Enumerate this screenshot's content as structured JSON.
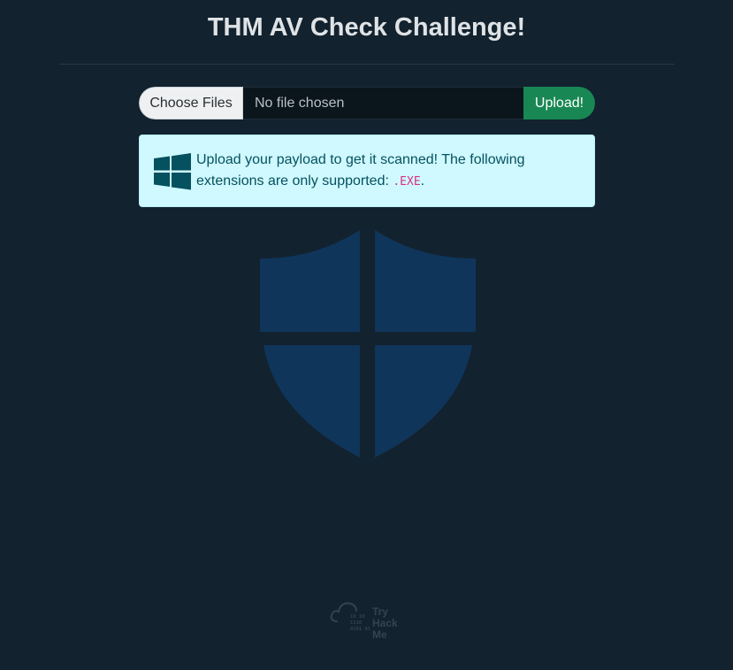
{
  "header": {
    "title": "THM AV Check Challenge!"
  },
  "upload": {
    "choose_label": "Choose Files",
    "file_status": "No file chosen",
    "submit_label": "Upload!"
  },
  "alert": {
    "message_prefix": "Upload your payload to get it scanned! The following extensions are only supported: ",
    "extension": ".EXE",
    "message_suffix": "."
  },
  "footer": {
    "brand_line1": "Try",
    "brand_line2": "Hack",
    "brand_line3": "Me",
    "logo_bits_1": "10 10",
    "logo_bits_2": "1110",
    "logo_bits_3": "0101 01"
  },
  "colors": {
    "background": "#12222f",
    "upload_button": "#198754",
    "alert_background": "#cff9ff",
    "alert_text": "#055160",
    "code_text": "#d63384",
    "shield": "#10355a"
  },
  "icons": {
    "alert_icon": "windows-icon",
    "hero": "shield-icon",
    "footer_logo": "tryhackme-logo"
  }
}
